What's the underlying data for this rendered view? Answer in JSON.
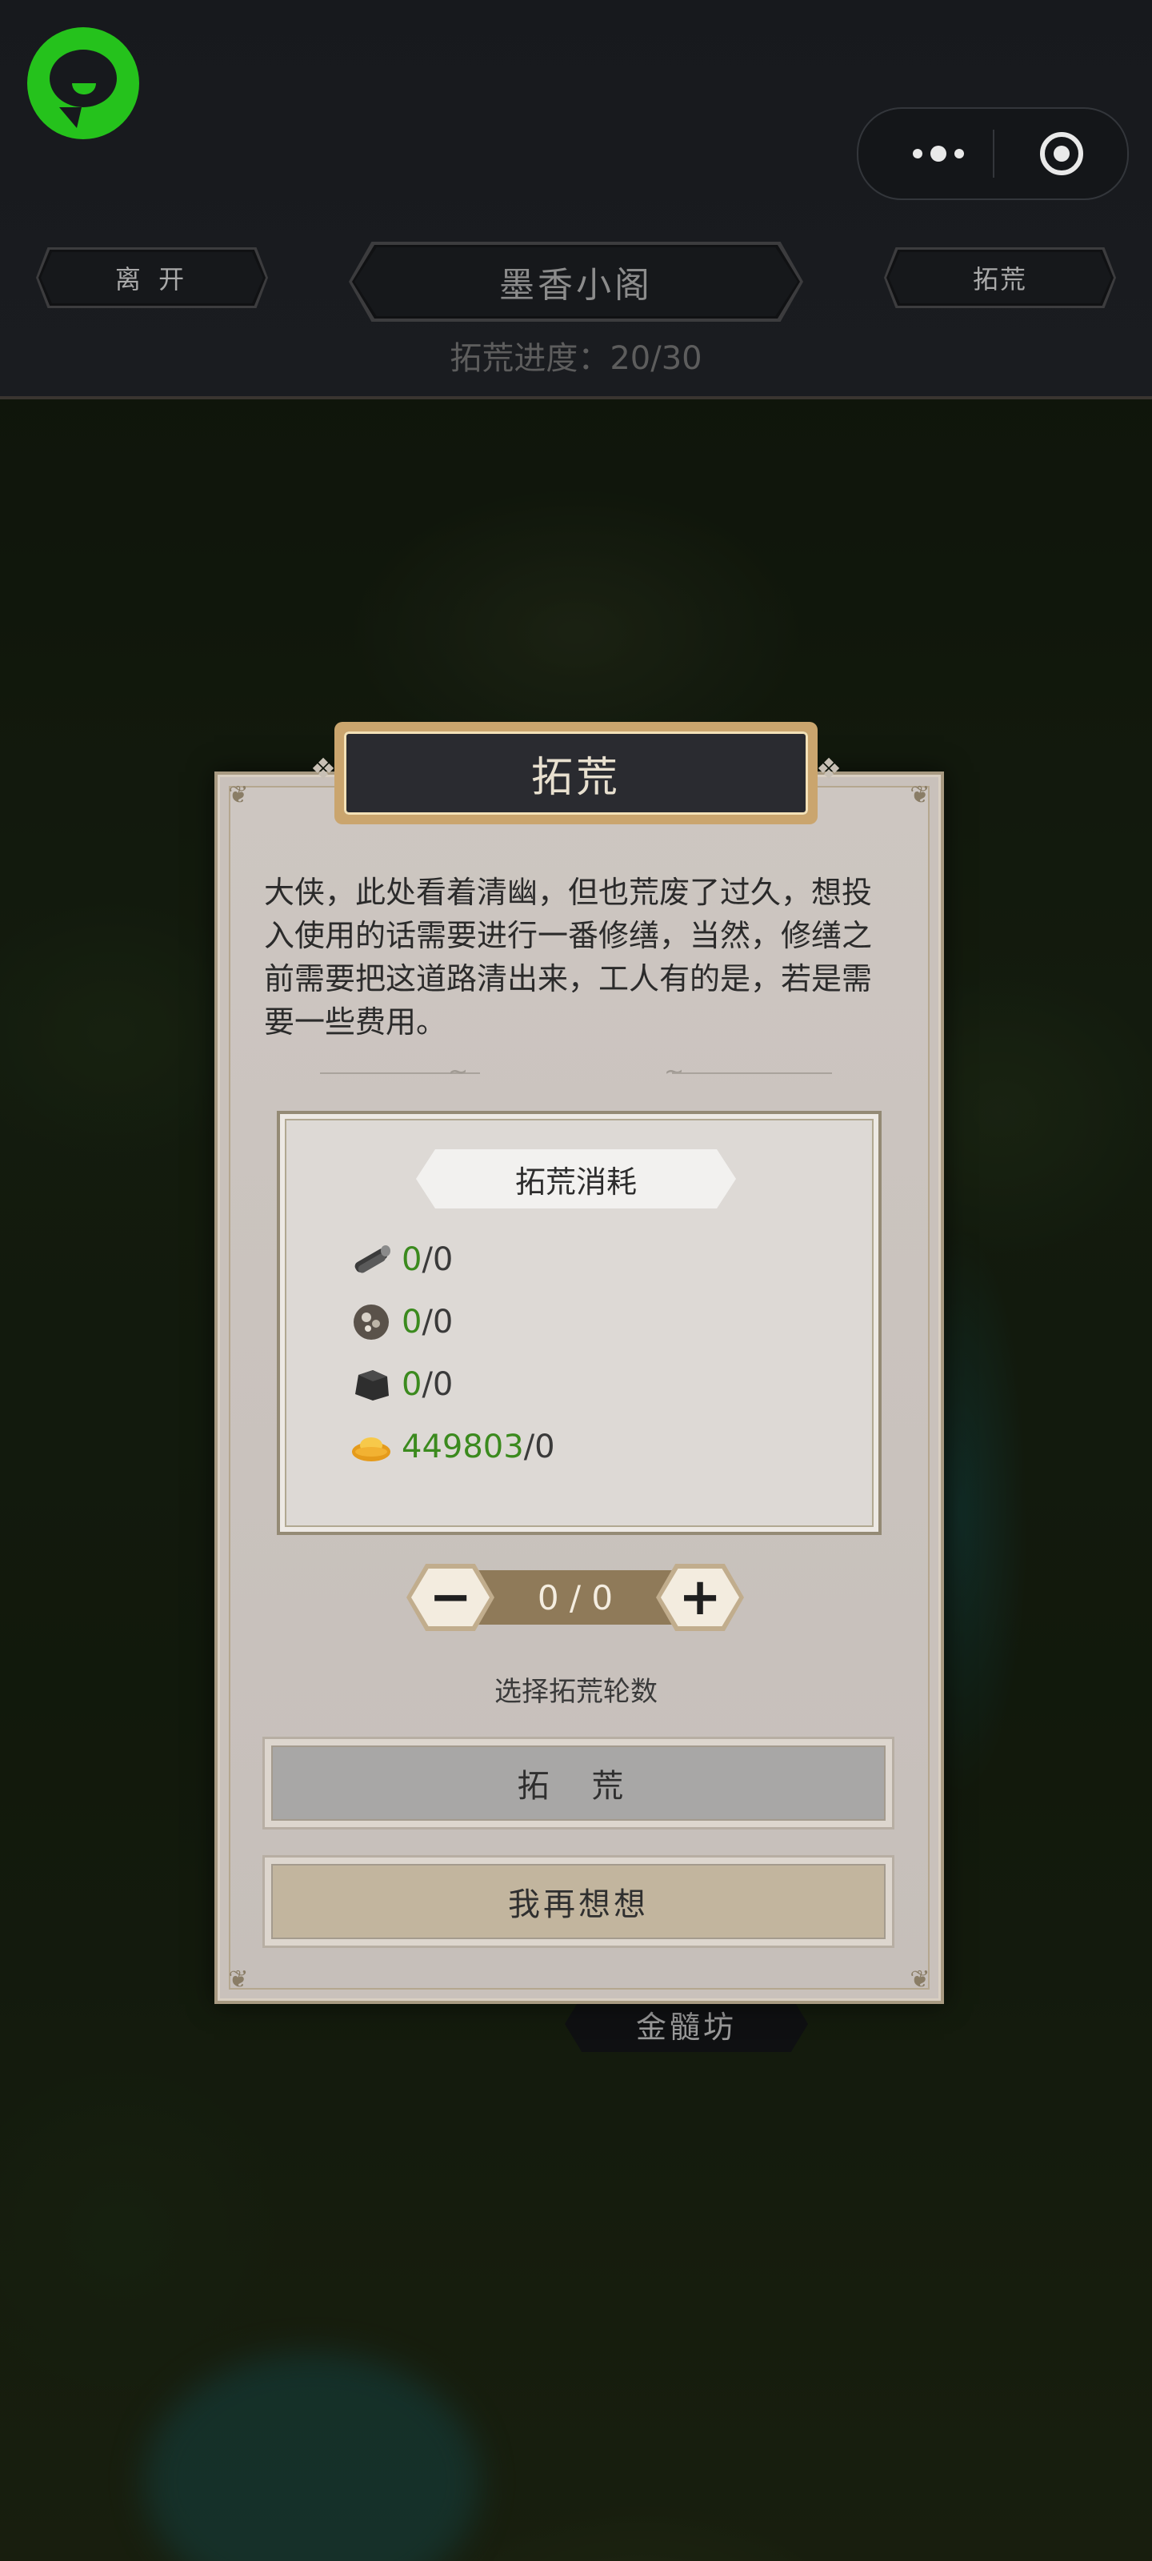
{
  "header": {
    "leave_label": "离 开",
    "location_title": "墨香小阁",
    "reclaim_label": "拓荒",
    "progress_text": "拓荒进度：20/30"
  },
  "dialog": {
    "title": "拓荒",
    "description": "大侠，此处看着清幽，但也荒废了过久，想投入使用的话需要进行一番修缮，当然，修缮之前需要把这道路清出来，工人有的是，若是需要一些费用。",
    "cost_title": "拓荒消耗",
    "costs": [
      {
        "icon": "wood-log-icon",
        "have": "0",
        "need": "/0"
      },
      {
        "icon": "ore-chunk-icon",
        "have": "0",
        "need": "/0"
      },
      {
        "icon": "stone-block-icon",
        "have": "0",
        "need": "/0"
      },
      {
        "icon": "gold-ingot-icon",
        "have": "449803",
        "need": "/0"
      }
    ],
    "stepper_value": "0 / 0",
    "stepper_caption": "选择拓荒轮数",
    "confirm_label": "拓 荒",
    "cancel_label": "我再想想"
  },
  "map": {
    "building_label": "金髓坊"
  },
  "colors": {
    "accent_green": "#3b8a1e",
    "logo_green": "#25c21c",
    "title_gold": "#caa56e"
  }
}
